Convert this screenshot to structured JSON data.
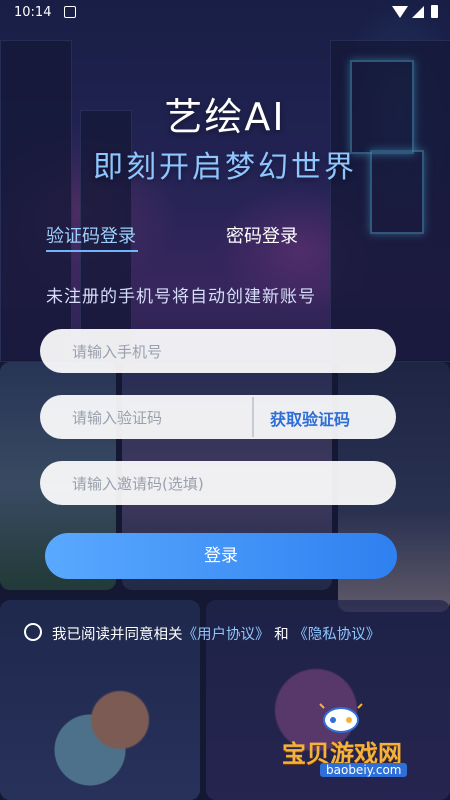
{
  "status_bar": {
    "time": "10:14"
  },
  "header": {
    "app_title": "艺绘AI",
    "slogan": "即刻开启梦幻世界"
  },
  "tabs": [
    {
      "label": "验证码登录",
      "active": true
    },
    {
      "label": "密码登录",
      "active": false
    }
  ],
  "hint": "未注册的手机号将自动创建新账号",
  "form": {
    "phone_placeholder": "请输入手机号",
    "code_placeholder": "请输入验证码",
    "get_code_label": "获取验证码",
    "invite_placeholder": "请输入邀请码(选填)",
    "login_label": "登录"
  },
  "agreement": {
    "prefix": "我已阅读并同意相关",
    "user_agreement": "《用户协议》",
    "and": "和",
    "privacy_policy": "《隐私协议》",
    "checked": false
  },
  "watermark": {
    "text": "宝贝游戏网",
    "url": "baobeiy.com"
  },
  "colors": {
    "accent": "#8ec6ff",
    "button_start": "#59a9ff",
    "button_end": "#2f80f0",
    "link": "#8ec6ff",
    "get_code": "#2d6ed8"
  }
}
